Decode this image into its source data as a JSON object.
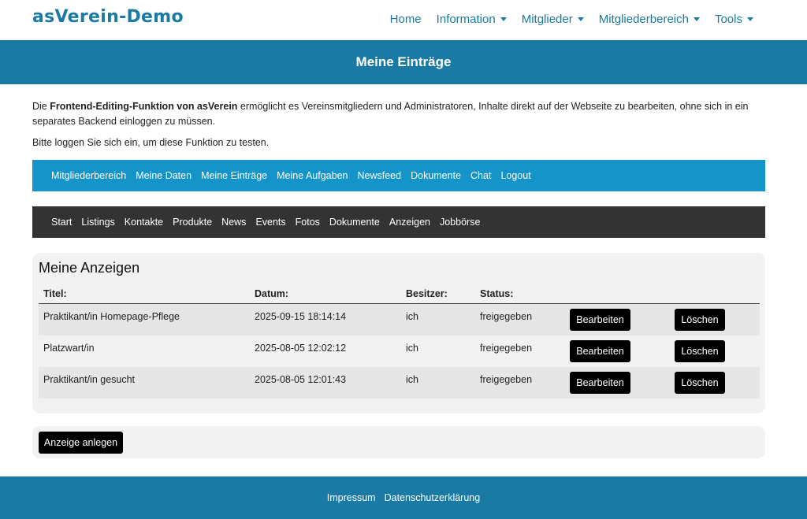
{
  "header": {
    "logo": "asVerein-Demo",
    "nav": [
      {
        "label": "Home",
        "dropdown": false
      },
      {
        "label": "Information",
        "dropdown": true
      },
      {
        "label": "Mitglieder",
        "dropdown": true
      },
      {
        "label": "Mitgliederbereich",
        "dropdown": true
      },
      {
        "label": "Tools",
        "dropdown": true
      }
    ]
  },
  "hero": {
    "title": "Meine Einträge"
  },
  "intro": {
    "prefix": "Die ",
    "bold": "Frontend-Editing-Funktion von asVerein",
    "suffix": " ermöglicht es Vereinsmitgliedern und Administratoren, Inhalte direkt auf der Webseite zu bearbeiten, ohne sich in ein separates Backend einloggen zu müssen.",
    "login_hint": "Bitte loggen Sie sich ein, um diese Funktion zu testen."
  },
  "member_nav": [
    "Mitgliederbereich",
    "Meine Daten",
    "Meine Einträge",
    "Meine Aufgaben",
    "Newsfeed",
    "Dokumente",
    "Chat",
    "Logout"
  ],
  "sub_nav": [
    "Start",
    "Listings",
    "Kontakte",
    "Produkte",
    "News",
    "Events",
    "Fotos",
    "Dokumente",
    "Anzeigen",
    "Jobbörse"
  ],
  "ads": {
    "heading": "Meine Anzeigen",
    "columns": {
      "title": "Titel:",
      "date": "Datum:",
      "owner": "Besitzer:",
      "status": "Status:"
    },
    "rows": [
      {
        "title": "Praktikant/in Homepage-Pflege",
        "date": "2025-09-15 18:14:14",
        "owner": "ich",
        "status": "freigegeben"
      },
      {
        "title": "Platzwart/in",
        "date": "2025-08-05 12:02:12",
        "owner": "ich",
        "status": "freigegeben"
      },
      {
        "title": "Praktikant/in gesucht",
        "date": "2025-08-05 12:01:43",
        "owner": "ich",
        "status": "freigegeben"
      }
    ],
    "edit_label": "Bearbeiten",
    "delete_label": "Löschen",
    "create_label": "Anzeige anlegen"
  },
  "footer": {
    "links": [
      "Impressum",
      "Datenschutzerklärung"
    ]
  },
  "colors": {
    "brand": "#1a7aa3",
    "member_nav": "#1594c9",
    "sub_nav": "#333333",
    "button": "#000000"
  }
}
